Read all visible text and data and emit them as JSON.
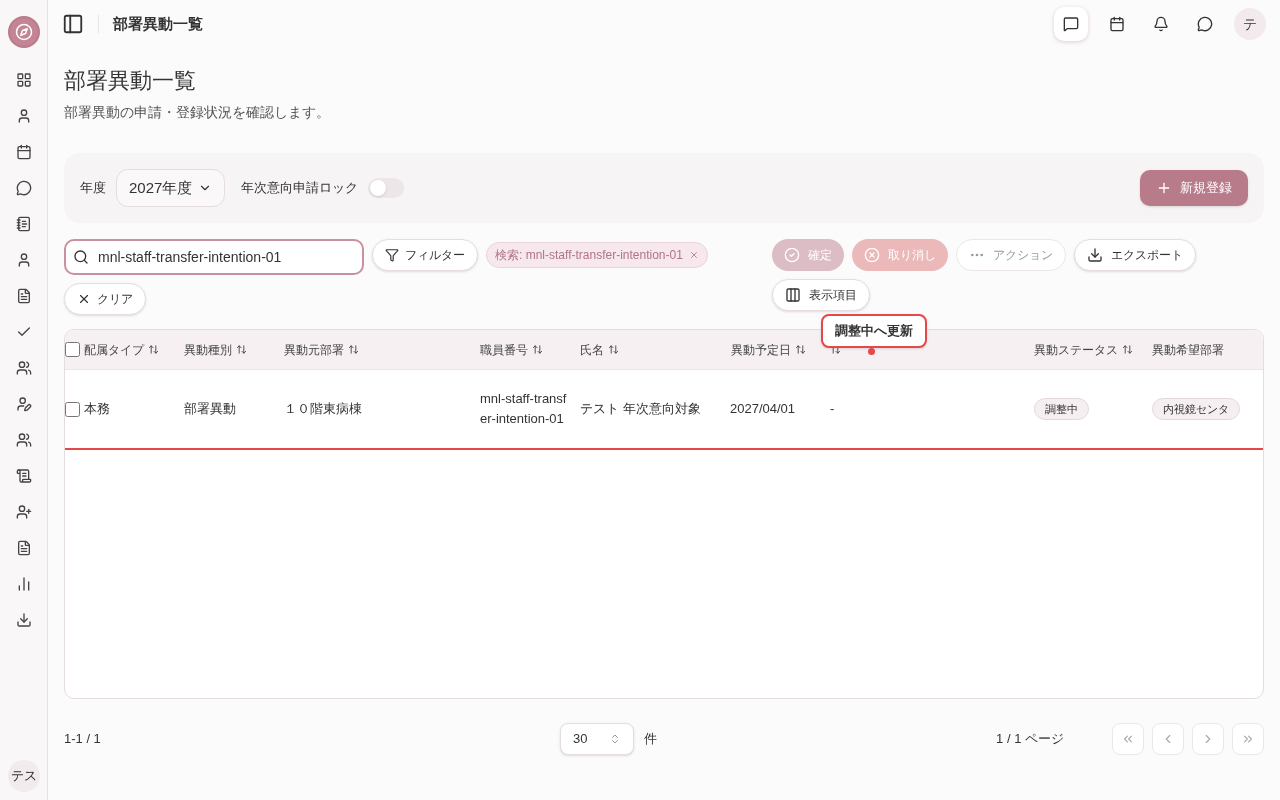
{
  "header": {
    "title": "部署異動一覧",
    "avatar": "テ"
  },
  "page": {
    "title": "部署異動一覧",
    "description": "部署異動の申請・登録状況を確認します。"
  },
  "controls": {
    "year_label": "年度",
    "year_value": "2027年度",
    "lock_label": "年次意向申請ロック",
    "lock_on": false,
    "new_button": "新規登録"
  },
  "toolbar": {
    "search_value": "mnl-staff-transfer-intention-01",
    "filter_button": "フィルター",
    "chip": "検索: mnl-staff-transfer-intention-01",
    "clear_button": "クリア",
    "actions": [
      {
        "kind": "confirm",
        "label": "確定",
        "disabled": true
      },
      {
        "kind": "cancel",
        "label": "取り消し",
        "disabled": true
      },
      {
        "kind": "more",
        "label": "アクション",
        "disabled": true
      },
      {
        "kind": "export",
        "label": "エクスポート",
        "disabled": false
      },
      {
        "kind": "columns",
        "label": "表示項目",
        "disabled": false
      }
    ]
  },
  "tooltip": "調整中へ更新",
  "table": {
    "all_checked": false,
    "columns": [
      {
        "label": "配属タイプ",
        "sortable": true
      },
      {
        "label": "異動種別",
        "sortable": true
      },
      {
        "label": "異動元部署",
        "sortable": true
      },
      {
        "label": "職員番号",
        "sortable": true
      },
      {
        "label": "氏名",
        "sortable": true
      },
      {
        "label": "異動予定日",
        "sortable": true
      },
      {
        "sortable": true
      },
      {
        "label": "異動ステータス",
        "sortable": true
      },
      {
        "label": "異動希望部署"
      }
    ],
    "rows": [
      {
        "checked": false,
        "highlighted": true,
        "cells": [
          {
            "kind": "text",
            "text": "本務"
          },
          {
            "kind": "text",
            "text": "部署異動"
          },
          {
            "kind": "text",
            "text": "１０階東病棟"
          },
          {
            "kind": "text",
            "text": "mnl-staff-transfer-intention-01"
          },
          {
            "kind": "text",
            "text": "テスト 年次意向対象"
          },
          {
            "kind": "text",
            "text": "2027/04/01"
          },
          {
            "kind": "text",
            "text": "-"
          },
          {
            "kind": "badge",
            "text": "調整中"
          },
          {
            "kind": "badge",
            "text": "内視鏡センタ"
          }
        ]
      }
    ]
  },
  "pagination": {
    "range": "1-1 / 1",
    "per_page": "30",
    "per_page_unit": "件",
    "page": "1 / 1 ページ",
    "first_disabled": true,
    "prev_disabled": true,
    "next_disabled": true,
    "last_disabled": true
  },
  "sidebar": {
    "user": "テス"
  }
}
